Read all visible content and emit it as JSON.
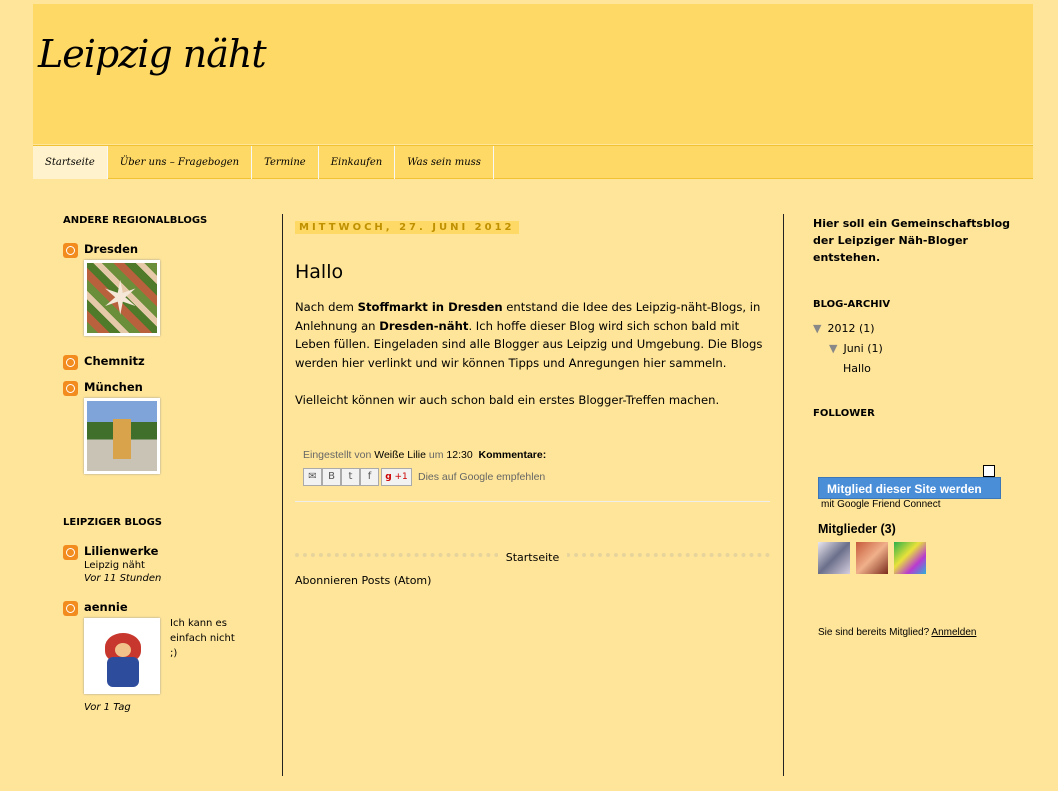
{
  "blog": {
    "title": "Leipzig näht"
  },
  "tabs": [
    {
      "label": "Startseite",
      "active": true
    },
    {
      "label": "Über uns – Fragebogen",
      "active": false
    },
    {
      "label": "Termine",
      "active": false
    },
    {
      "label": "Einkaufen",
      "active": false
    },
    {
      "label": "Was sein muss",
      "active": false
    }
  ],
  "left_sidebar": {
    "regional_title": "ANDERE REGIONALBLOGS",
    "regional": [
      {
        "name": "Dresden"
      },
      {
        "name": "Chemnitz"
      },
      {
        "name": "München"
      }
    ],
    "leipzig_title": "LEIPZIGER BLOGS",
    "leipzig": [
      {
        "name": "Lilienwerke",
        "post": "Leipzig näht",
        "time": "Vor 11 Stunden"
      },
      {
        "name": "aennie",
        "post": "Ich kann es einfach nicht ;)",
        "time": "Vor 1 Tag"
      }
    ]
  },
  "post": {
    "date": "MITTWOCH, 27. JUNI 2012",
    "title": "Hallo",
    "body_p1_a": "Nach dem ",
    "body_p1_b": "Stoffmarkt in Dresden",
    "body_p1_c": " entstand die Idee des Leipzig-näht-Blogs, in Anlehnung an ",
    "body_p1_d": "Dresden-näht",
    "body_p1_e": ". Ich hoffe dieser Blog wird sich schon bald mit Leben füllen. Eingeladen sind alle Blogger aus Leipzig und Umgebung. Die Blogs werden hier verlinkt und wir können Tipps und Anregungen hier sammeln.",
    "body_p2": " Vielleicht können wir auch schon bald ein erstes Blogger-Treffen machen.",
    "posted_by_label": "Eingestellt von",
    "author": "Weiße Lilie",
    "at_label": "um",
    "time": "12:30",
    "comments_label": "Kommentare:",
    "plus_one": "+1",
    "share_text": "Dies auf Google empfehlen"
  },
  "pager": {
    "home": "Startseite"
  },
  "subscribe": "Abonnieren Posts (Atom)",
  "right_sidebar": {
    "intro": "Hier soll ein Gemeinschaftsblog der Leipziger Näh-Bloger entstehen.",
    "archive_title": "BLOG-ARCHIV",
    "year": "2012",
    "year_count": "(1)",
    "month": "Juni",
    "month_count": "(1)",
    "post_link": "Hallo",
    "follower_title": "FOLLOWER",
    "join_button": "Mitglied dieser Site werden",
    "gfc_sub": "mit Google Friend Connect",
    "members_title": "Mitglieder (3)",
    "already_text": "Sie sind bereits Mitglied?",
    "login_link": "Anmelden"
  },
  "colors": {
    "page_bg": "#ffe599",
    "header_bg": "#ffd966",
    "date_text": "#bf9000",
    "gfc_button": "#4a8ed8"
  }
}
